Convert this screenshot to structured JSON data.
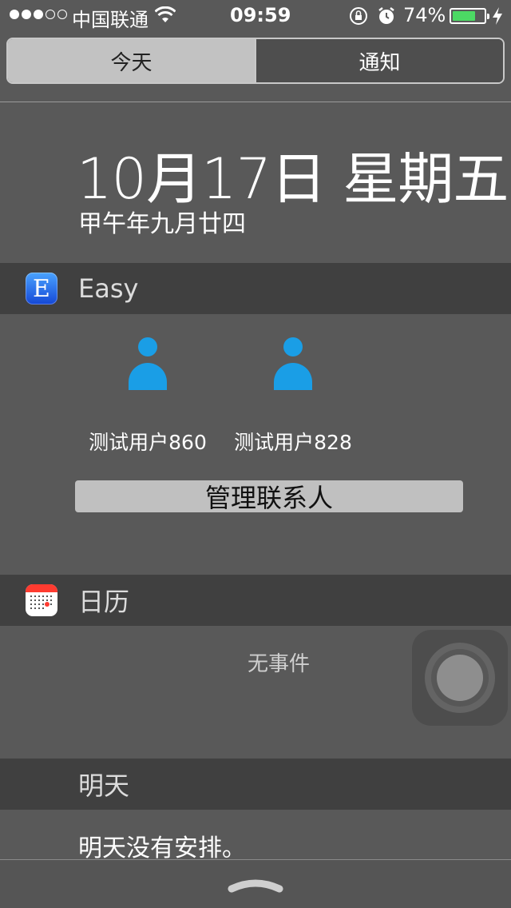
{
  "status_bar": {
    "carrier": "中国联通",
    "time": "09:59",
    "battery_percent": "74%",
    "battery_level": 0.74,
    "signal_bars": 3,
    "signal_total": 5
  },
  "segments": {
    "today": "今天",
    "notifications": "通知"
  },
  "date": {
    "main": "10月17日 星期五",
    "lunar": "甲午年九月廿四"
  },
  "easy_widget": {
    "title": "Easy",
    "icon_letter": "E",
    "contacts": [
      {
        "name": "测试用户860"
      },
      {
        "name": "测试用户828"
      }
    ],
    "manage_button": "管理联系人"
  },
  "calendar_widget": {
    "title": "日历",
    "empty_text": "无事件"
  },
  "tomorrow": {
    "title": "明天",
    "text": "明天没有安排。"
  },
  "colors": {
    "accent_blue": "#1a9ee6",
    "battery_green": "#4cd964",
    "calendar_red": "#ff3b30"
  }
}
